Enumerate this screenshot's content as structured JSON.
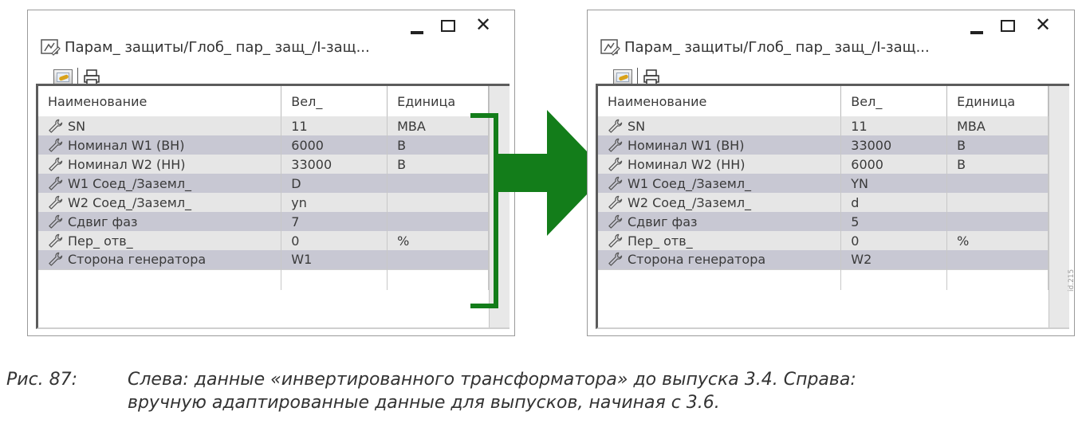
{
  "colors": {
    "arrow": "#137d1a",
    "row_a": "#e6e6e6",
    "row_b": "#c8c8d3"
  },
  "windows": [
    {
      "title": "Парам_ защиты/Глоб_ пар_ защ_/I-защ...",
      "columns": [
        "Наименование",
        "Вел_",
        "Единица"
      ],
      "rows": [
        {
          "name": "SN",
          "value": "11",
          "unit": "MBA"
        },
        {
          "name": "Номинал W1 (BH)",
          "value": "6000",
          "unit": "B"
        },
        {
          "name": "Номинал W2 (HH)",
          "value": "33000",
          "unit": "B"
        },
        {
          "name": "W1 Соед_/Заземл_",
          "value": "D",
          "unit": ""
        },
        {
          "name": "W2 Соед_/Заземл_",
          "value": "yn",
          "unit": ""
        },
        {
          "name": "Сдвиг фаз",
          "value": "7",
          "unit": ""
        },
        {
          "name": "Пер_ отв_",
          "value": "0",
          "unit": "%"
        },
        {
          "name": "Сторона генератора",
          "value": "W1",
          "unit": ""
        }
      ]
    },
    {
      "title": "Парам_ защиты/Глоб_ пар_ защ_/I-защ...",
      "columns": [
        "Наименование",
        "Вел_",
        "Единица"
      ],
      "rows": [
        {
          "name": "SN",
          "value": "11",
          "unit": "MBA"
        },
        {
          "name": "Номинал W1 (BH)",
          "value": "33000",
          "unit": "B"
        },
        {
          "name": "Номинал W2 (HH)",
          "value": "6000",
          "unit": "B"
        },
        {
          "name": "W1 Соед_/Заземл_",
          "value": "YN",
          "unit": ""
        },
        {
          "name": "W2 Соед_/Заземл_",
          "value": "d",
          "unit": ""
        },
        {
          "name": "Сдвиг фаз",
          "value": "5",
          "unit": ""
        },
        {
          "name": "Пер_ отв_",
          "value": "0",
          "unit": "%"
        },
        {
          "name": "Сторона генератора",
          "value": "W2",
          "unit": ""
        }
      ]
    }
  ],
  "caption": {
    "number": "Рис. 87:",
    "line1": "Слева: данные «инвертированного трансформатора» до выпуска 3.4. Справа:",
    "line2": "вручную адаптированные данные для выпусков, начиная с 3.6."
  },
  "image_id": "id.215"
}
